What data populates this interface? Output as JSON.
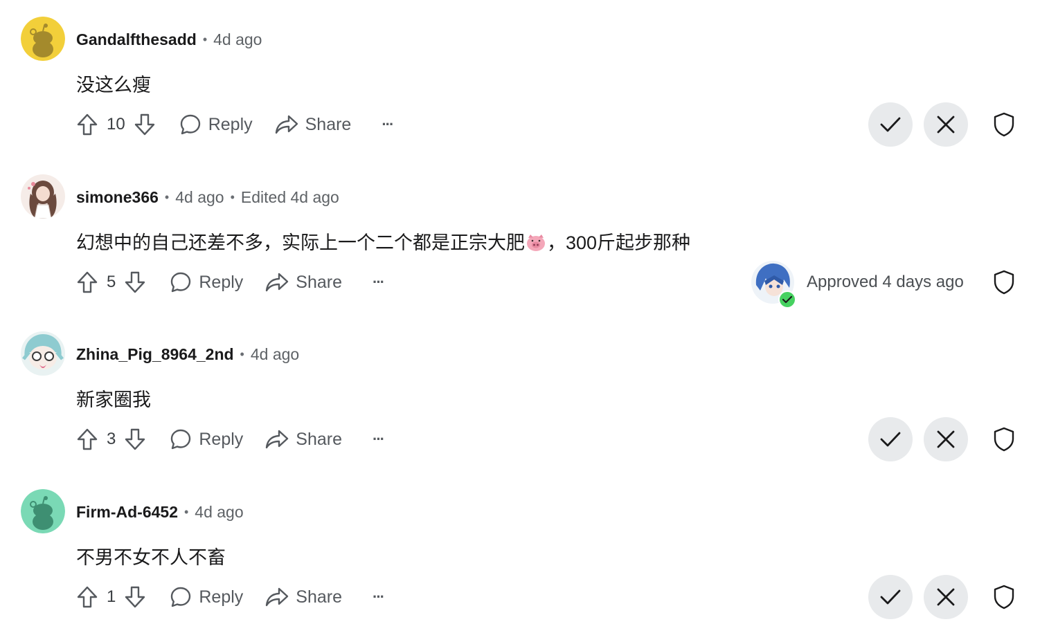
{
  "comments": [
    {
      "username": "Gandalfthesadd",
      "time": "4d ago",
      "edited": "",
      "body_before": "没这么瘦",
      "body_after": "",
      "score": "10",
      "reply_label": "Reply",
      "share_label": "Share",
      "more_label": "···",
      "status": "pending"
    },
    {
      "username": "simone366",
      "time": "4d ago",
      "edited": "Edited 4d ago",
      "body_before": "幻想中的自己还差不多，实际上一个二个都是正宗大肥",
      "body_after": "，300斤起步那种",
      "score": "5",
      "reply_label": "Reply",
      "share_label": "Share",
      "more_label": "···",
      "status": "approved",
      "approved_text": "Approved 4 days ago"
    },
    {
      "username": "Zhina_Pig_8964_2nd",
      "time": "4d ago",
      "edited": "",
      "body_before": "新家圈我",
      "body_after": "",
      "score": "3",
      "reply_label": "Reply",
      "share_label": "Share",
      "more_label": "···",
      "status": "pending"
    },
    {
      "username": "Firm-Ad-6452",
      "time": "4d ago",
      "edited": "",
      "body_before": "不男不女不人不畜",
      "body_after": "",
      "score": "1",
      "reply_label": "Reply",
      "share_label": "Share",
      "more_label": "···",
      "status": "pending"
    }
  ],
  "icons": {
    "upvote": "arrow-up-outline-icon",
    "downvote": "arrow-down-outline-icon",
    "reply": "speech-bubble-icon",
    "share": "share-arrow-icon",
    "more": "ellipsis-icon",
    "approve": "checkmark-icon",
    "remove": "x-icon",
    "mod": "shield-icon",
    "emoji": "pig-face-emoji"
  },
  "colors": {
    "avatar_yellow": "#f2cf3a",
    "avatar_green": "#7ad9b5",
    "mod_button_bg": "#e8eaec",
    "approved_badge": "#46d160",
    "meta_gray": "#5e6266"
  }
}
